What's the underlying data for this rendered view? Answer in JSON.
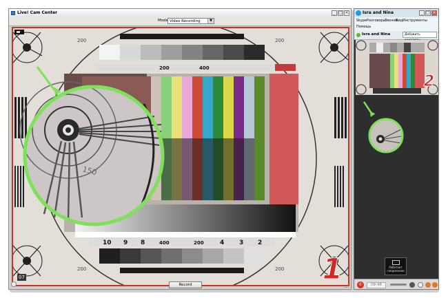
{
  "left_window": {
    "title": "Live! Cam Center",
    "mode_label": "Mode:",
    "mode_value": "Video Recording",
    "record_label": "Record",
    "timestamp": "07",
    "annotation_number": "1",
    "chart": {
      "label_200": "200",
      "label_400": "400",
      "label_150": "150",
      "bottom_numbers": [
        "10",
        "9",
        "8",
        "400",
        "200",
        "4",
        "3",
        "2"
      ]
    }
  },
  "right_window": {
    "title": "Isra and Nina",
    "menu": [
      "Skype",
      "Разговоры",
      "Звонки",
      "Вид",
      "Инструменты"
    ],
    "help": "Помощь",
    "contact_name": "Isra and Nina",
    "add_contacts": "Добавить контакты",
    "annotation_number": "2",
    "timer": "09:48",
    "popup_text": "Работает соединение"
  },
  "colors": {
    "annotation_green": "#7fe05a",
    "annotation_red": "#d02a22",
    "hangup_red": "#d62b1d"
  },
  "icons": [
    "app-icon",
    "minimize-icon",
    "maximize-icon",
    "close-icon",
    "skype-icon",
    "chevron-down-icon",
    "hangup-icon",
    "gear-icon",
    "resize-grip-icon"
  ]
}
